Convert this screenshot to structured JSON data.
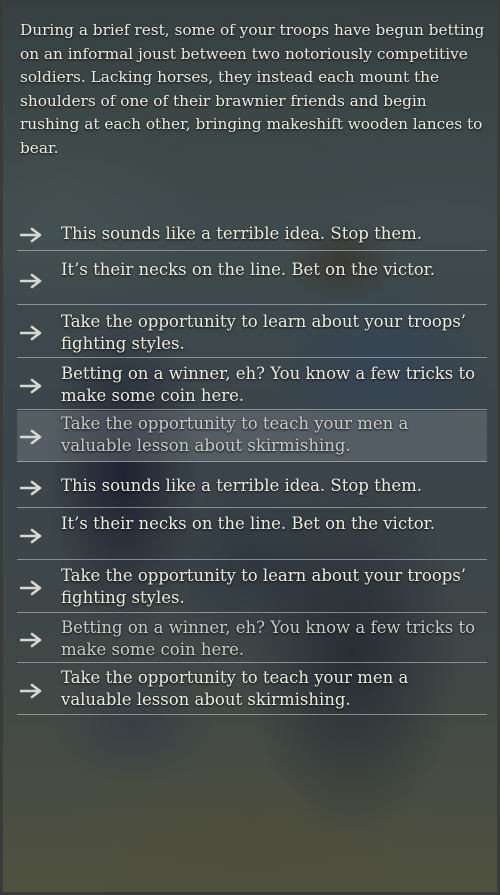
{
  "event": {
    "description": "During a brief rest, some of your troops have begun betting on an informal joust between two notoriously competitive soldiers. Lacking horses, they instead each mount the shoulders of one of their brawnier friends and begin rushing at each other, bringing makeshift wooden lances to bear."
  },
  "options": [
    {
      "label": "This sounds like a terrible idea. Stop them.",
      "icon": "arrow-right-icon"
    },
    {
      "label": "It’s their necks on the line. Bet on the victor.",
      "icon": "arrow-right-icon"
    },
    {
      "label": "Take the opportunity to learn about your troops’ fighting styles.",
      "icon": "arrow-right-icon"
    },
    {
      "label": "Betting on a winner, eh? You know a few tricks to make some coin here.",
      "icon": "arrow-right-icon"
    },
    {
      "label": "Take the opportunity to teach your men a valuable lesson about skirmishing.",
      "icon": "arrow-right-icon"
    },
    {
      "label": "This sounds like a terrible idea. Stop them.",
      "icon": "arrow-right-icon"
    },
    {
      "label": "It’s their necks on the line. Bet on the victor.",
      "icon": "arrow-right-icon"
    },
    {
      "label": "Take the opportunity to learn about your troops’ fighting styles.",
      "icon": "arrow-right-icon"
    },
    {
      "label": "Betting on a winner, eh? You know a few tricks to make some coin here.",
      "icon": "arrow-right-icon"
    },
    {
      "label": "Take the opportunity to teach your men a valuable lesson about skirmishing.",
      "icon": "arrow-right-icon"
    }
  ],
  "colors": {
    "text": "#ececdf",
    "arrow": "#d6d8d2",
    "divider": "#c8cdc8"
  }
}
